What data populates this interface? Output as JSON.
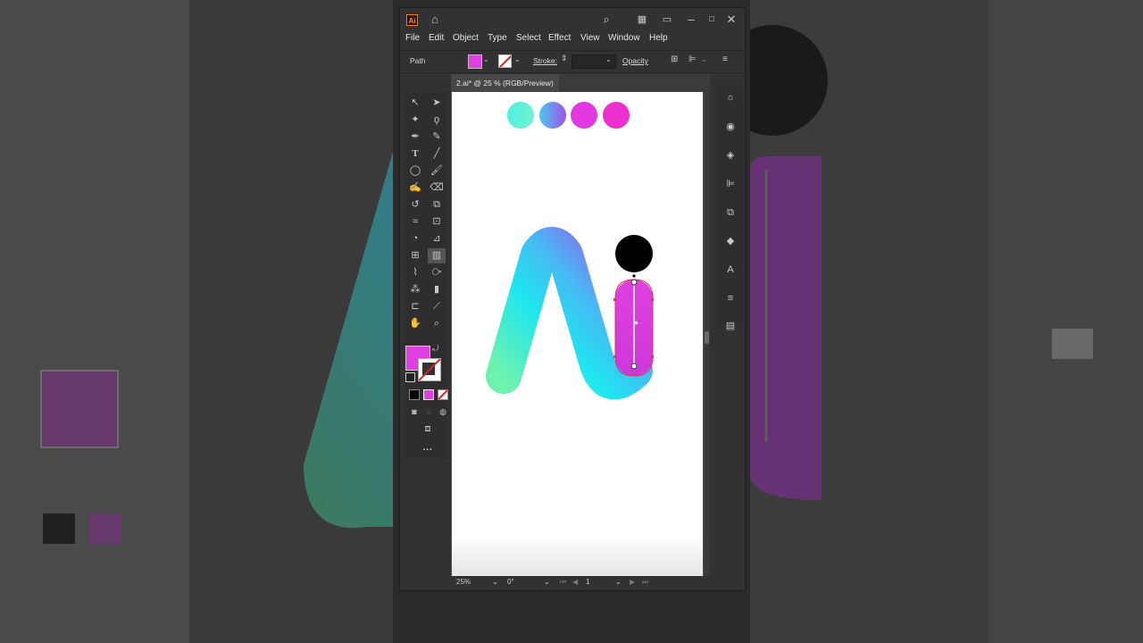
{
  "app": {
    "logo": "Ai",
    "icons": [
      "home-icon",
      "search-icon",
      "arrange-documents-icon",
      "panel-icon",
      "minimize-icon",
      "maximize-icon",
      "close-icon"
    ]
  },
  "menu": [
    "File",
    "Edit",
    "Object",
    "Type",
    "Select",
    "Effect",
    "View",
    "Window",
    "Help"
  ],
  "control_bar": {
    "selection_label": "Path",
    "stroke_label": "Stroke:",
    "opacity_label": "Opacity",
    "fill_color": "#e040e0"
  },
  "document_tab": {
    "title": "2.ai* @ 25 % (RGB/Preview)"
  },
  "status_bar": {
    "zoom": "25%",
    "rotation": "0°",
    "artboard_number": "1"
  },
  "colors": {
    "swatch_1": "#4ff0e0",
    "swatch_2": "#7a7ef0",
    "swatch_3": "#e238e0",
    "swatch_4": "#ee2fcf",
    "fill": "#e040e0",
    "selection": "#e8305a"
  }
}
